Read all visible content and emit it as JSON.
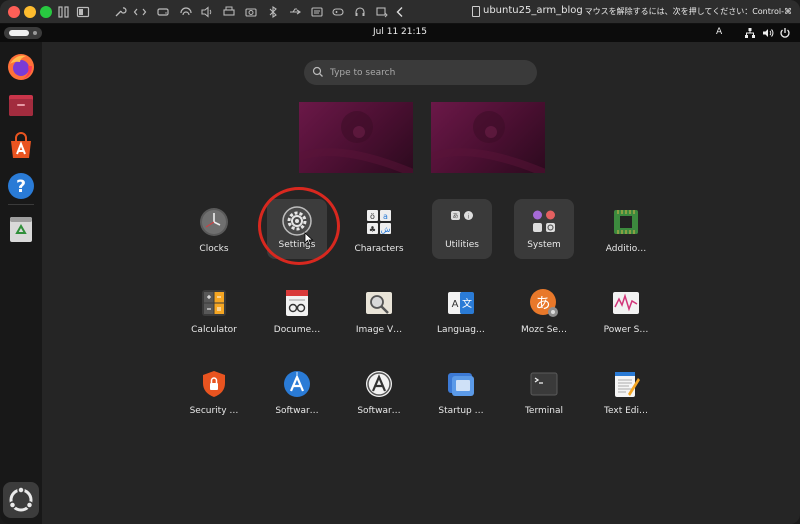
{
  "titlebar": {
    "vm_title": "ubuntu25_arm_blog",
    "release_hint": "マウスを解除するには、次を押してください：Control-⌘"
  },
  "topbar": {
    "clock": "Jul 11  21:15",
    "input_method": "A"
  },
  "search": {
    "placeholder": "Type to search"
  },
  "apps": [
    {
      "label": "Clocks",
      "icon": "clocks-icon"
    },
    {
      "label": "Settings",
      "icon": "settings-gear-icon"
    },
    {
      "label": "Characters",
      "icon": "characters-icon"
    },
    {
      "label": "Utilities",
      "icon": "utilities-folder-icon"
    },
    {
      "label": "System",
      "icon": "system-folder-icon"
    },
    {
      "label": "Additio…",
      "icon": "additional-drivers-icon"
    },
    {
      "label": "Calculator",
      "icon": "calculator-icon"
    },
    {
      "label": "Docume…",
      "icon": "document-scanner-icon"
    },
    {
      "label": "Image V…",
      "icon": "image-viewer-icon"
    },
    {
      "label": "Languag…",
      "icon": "language-support-icon"
    },
    {
      "label": "Mozc Se…",
      "icon": "mozc-settings-icon"
    },
    {
      "label": "Power S…",
      "icon": "power-statistics-icon"
    },
    {
      "label": "Security …",
      "icon": "security-center-icon"
    },
    {
      "label": "Softwar…",
      "icon": "software-updater-icon"
    },
    {
      "label": "Softwar…",
      "icon": "software-properties-icon"
    },
    {
      "label": "Startup …",
      "icon": "startup-disk-icon"
    },
    {
      "label": "Terminal",
      "icon": "terminal-icon"
    },
    {
      "label": "Text Edi…",
      "icon": "text-editor-icon"
    }
  ],
  "dock": [
    "firefox-icon",
    "files-icon",
    "app-center-icon",
    "help-icon",
    "trash-icon",
    "show-apps-icon"
  ],
  "colors": {
    "accent": "#e95420",
    "highlight_ring": "#d8281f"
  }
}
